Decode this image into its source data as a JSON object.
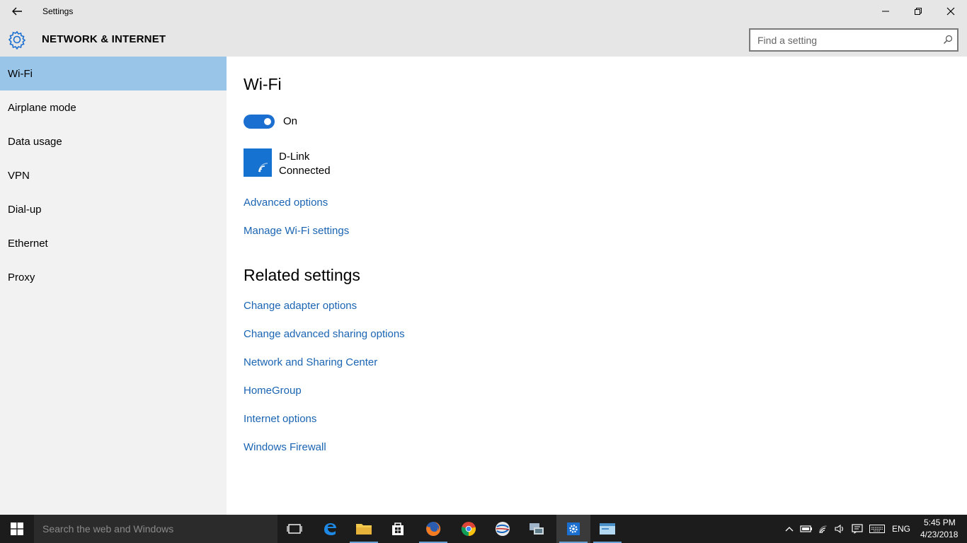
{
  "window": {
    "title": "Settings",
    "section": "NETWORK & INTERNET"
  },
  "search": {
    "placeholder": "Find a setting"
  },
  "sidebar": {
    "items": [
      {
        "label": "Wi-Fi",
        "active": true
      },
      {
        "label": "Airplane mode"
      },
      {
        "label": "Data usage"
      },
      {
        "label": "VPN"
      },
      {
        "label": "Dial-up"
      },
      {
        "label": "Ethernet"
      },
      {
        "label": "Proxy"
      }
    ]
  },
  "main": {
    "heading": "Wi-Fi",
    "toggle_state": "On",
    "network": {
      "name": "D-Link",
      "status": "Connected"
    },
    "links": [
      "Advanced options",
      "Manage Wi-Fi settings"
    ],
    "related_heading": "Related settings",
    "related_links": [
      "Change adapter options",
      "Change advanced sharing options",
      "Network and Sharing Center",
      "HomeGroup",
      "Internet options",
      "Windows Firewall"
    ]
  },
  "taskbar": {
    "search_placeholder": "Search the web and Windows",
    "apps": [
      "task-view",
      "edge",
      "file-explorer",
      "store",
      "firefox",
      "chrome",
      "app-globe",
      "app-network",
      "settings",
      "app-window"
    ],
    "tray": {
      "language": "ENG",
      "time": "5:45 PM",
      "date": "4/23/2018"
    }
  },
  "colors": {
    "accent": "#1a6fd0",
    "link": "#1a64b2",
    "sidebar_active": "#99c5e8",
    "titlebar": "#e6e6e6",
    "sidebar": "#f2f2f2",
    "taskbar": "#1c1c1c"
  }
}
